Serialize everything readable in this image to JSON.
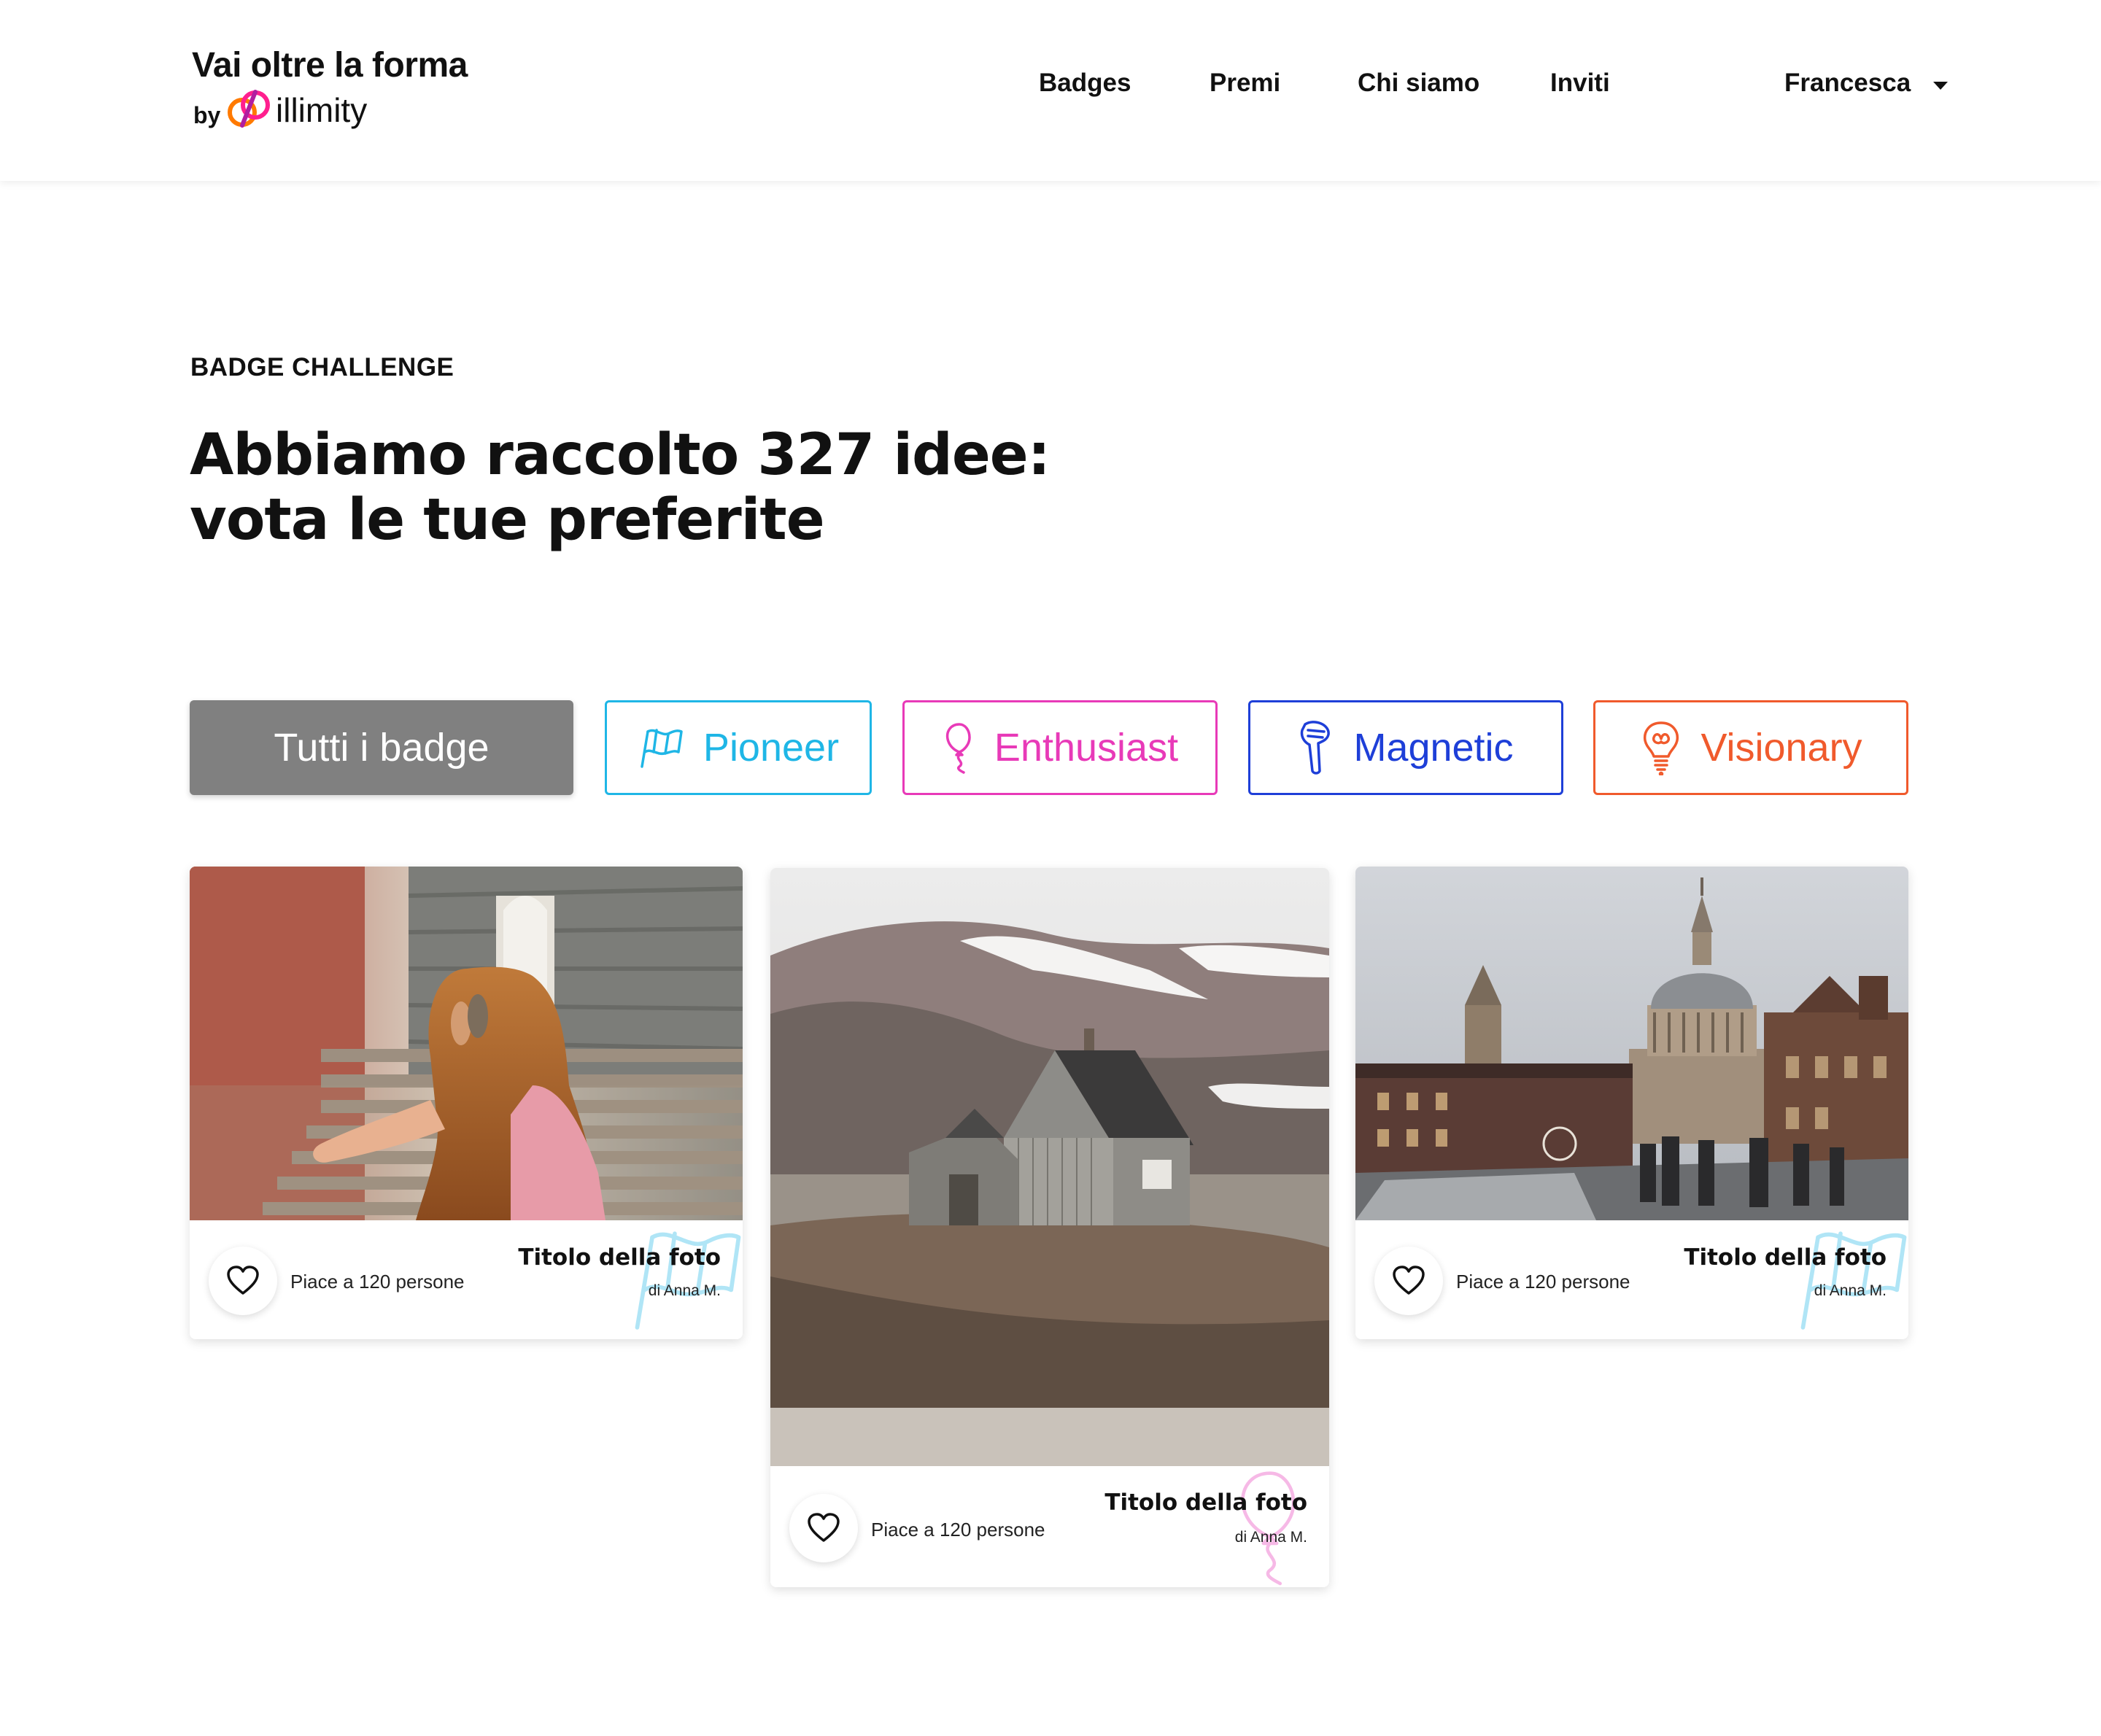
{
  "brand": {
    "title": "Vai oltre la forma",
    "by": "by",
    "name": "illimity",
    "colors": [
      "#ff1f8e",
      "#ff7a00"
    ]
  },
  "nav": {
    "items": [
      "Badges",
      "Premi",
      "Chi siamo",
      "Inviti"
    ],
    "user": "Francesca",
    "user_icon": "chevron-down-icon"
  },
  "hero": {
    "eyebrow": "BADGE CHALLENGE",
    "headline_line1": "Abbiamo raccolto 327 idee:",
    "headline_line2": "vota le tue preferite"
  },
  "filters": {
    "all": {
      "label": "Tutti i badge",
      "active": true,
      "color": "#808080"
    },
    "pioneer": {
      "label": "Pioneer",
      "icon": "flag-icon",
      "color": "#1fb6e6"
    },
    "enthusiast": {
      "label": "Enthusiast",
      "icon": "balloon-icon",
      "color": "#e83ab8"
    },
    "magnetic": {
      "label": "Magnetic",
      "icon": "magnet-icon",
      "color": "#1e3fd8"
    },
    "visionary": {
      "label": "Visionary",
      "icon": "lightbulb-icon",
      "color": "#f05a2c"
    }
  },
  "cards": [
    {
      "title": "Titolo della foto",
      "author": "di Anna M.",
      "likes": "Piace a 120 persone",
      "badge": "pioneer",
      "photo": "girl-on-stairs"
    },
    {
      "title": "Titolo della foto",
      "author": "di Anna M.",
      "likes": "Piace a 120 persone",
      "badge": "enthusiast",
      "photo": "wooden-house-on-cliff"
    },
    {
      "title": "Titolo della foto",
      "author": "di Anna M.",
      "likes": "Piace a 120 persone",
      "badge": "pioneer",
      "photo": "st-pauls-london"
    }
  ]
}
